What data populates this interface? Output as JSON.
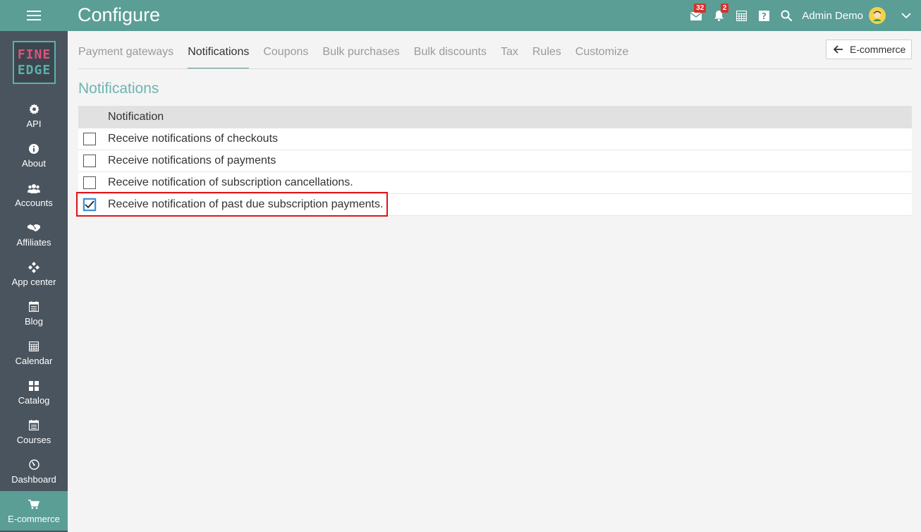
{
  "header": {
    "title": "Configure",
    "messages_badge": "32",
    "alerts_badge": "2",
    "user_name": "Admin Demo"
  },
  "logo": {
    "line1": "FINE",
    "line2": "EDGE"
  },
  "sidebar": {
    "items": [
      {
        "label": "API",
        "icon": "gear-icon"
      },
      {
        "label": "About",
        "icon": "info-icon"
      },
      {
        "label": "Accounts",
        "icon": "users-icon"
      },
      {
        "label": "Affiliates",
        "icon": "handshake-icon"
      },
      {
        "label": "App center",
        "icon": "diamond-icon"
      },
      {
        "label": "Blog",
        "icon": "blog-icon"
      },
      {
        "label": "Calendar",
        "icon": "calendar-icon"
      },
      {
        "label": "Catalog",
        "icon": "grid-icon"
      },
      {
        "label": "Courses",
        "icon": "courses-icon"
      },
      {
        "label": "Dashboard",
        "icon": "gauge-icon"
      },
      {
        "label": "E-commerce",
        "icon": "cart-icon",
        "active": true
      }
    ]
  },
  "tabs": [
    {
      "label": "Payment gateways"
    },
    {
      "label": "Notifications",
      "active": true
    },
    {
      "label": "Coupons"
    },
    {
      "label": "Bulk purchases"
    },
    {
      "label": "Bulk discounts"
    },
    {
      "label": "Tax"
    },
    {
      "label": "Rules"
    },
    {
      "label": "Customize"
    }
  ],
  "back_button": {
    "label": "E-commerce"
  },
  "section": {
    "title": "Notifications"
  },
  "table": {
    "header": "Notification",
    "rows": [
      {
        "label": "Receive notifications of checkouts",
        "checked": false
      },
      {
        "label": "Receive notifications of payments",
        "checked": false
      },
      {
        "label": "Receive notification of subscription cancellations.",
        "checked": false
      },
      {
        "label": "Receive notification of past due subscription payments.",
        "checked": true
      }
    ]
  },
  "colors": {
    "accent": "#5a9e96",
    "sidebar": "#4a545e",
    "highlight": "#e0141a",
    "badge": "#d9302b"
  }
}
